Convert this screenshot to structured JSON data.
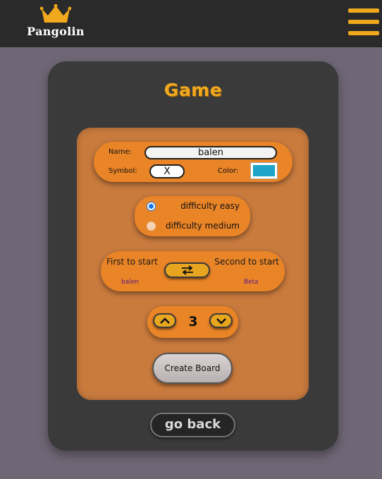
{
  "header": {
    "brand": "Pangolin",
    "logo_icon": "crown-icon",
    "menu_icon": "hamburger-menu-icon",
    "accent_color": "#f0a81c"
  },
  "game": {
    "title": "Game",
    "player": {
      "name_label": "Name:",
      "name_value": "balen",
      "symbol_label": "Symbol:",
      "symbol_value": "X",
      "color_label": "Color:",
      "color_value": "#1ea3c9"
    },
    "difficulty": {
      "options": [
        "difficulty easy",
        "difficulty medium"
      ],
      "selected": "difficulty easy"
    },
    "turn_order": {
      "first_label": "First to start",
      "second_label": "Second to start",
      "first_player": "balen",
      "second_player": "Beta",
      "swap_icon": "swap-arrows-icon"
    },
    "board_size": {
      "value": "3",
      "increment_icon": "chevron-up-icon",
      "decrement_icon": "chevron-down-icon"
    },
    "create_button": "Create Board",
    "back_button": "go back"
  }
}
